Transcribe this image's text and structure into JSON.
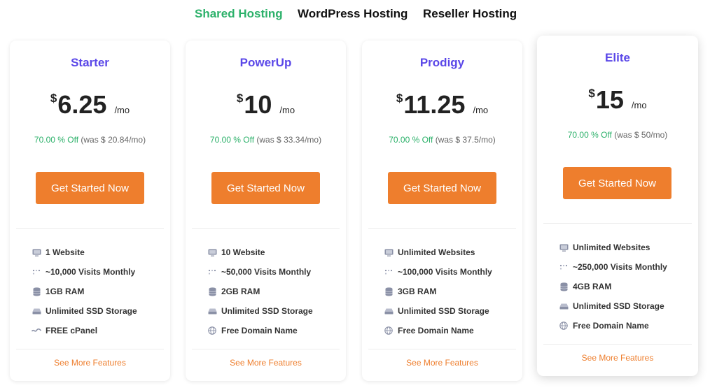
{
  "tabs": [
    {
      "label": "Shared Hosting",
      "active": true
    },
    {
      "label": "WordPress Hosting",
      "active": false
    },
    {
      "label": "Reseller Hosting",
      "active": false
    }
  ],
  "plans": [
    {
      "name": "Starter",
      "currency": "$",
      "price": "6.25",
      "period": "/mo",
      "discount_off": "70.00 % Off",
      "discount_was": "(was $ 20.84/mo)",
      "cta": "Get Started Now",
      "features": [
        {
          "icon": "monitor-icon",
          "text": "1 Website"
        },
        {
          "icon": "visits-icon",
          "text": "~10,000 Visits Monthly"
        },
        {
          "icon": "database-icon",
          "text": "1GB RAM"
        },
        {
          "icon": "drive-icon",
          "text": "Unlimited SSD Storage"
        },
        {
          "icon": "cpanel-icon",
          "text": "FREE cPanel"
        }
      ],
      "more": "See More Features"
    },
    {
      "name": "PowerUp",
      "currency": "$",
      "price": "10",
      "period": "/mo",
      "discount_off": "70.00 % Off",
      "discount_was": "(was $ 33.34/mo)",
      "cta": "Get Started Now",
      "features": [
        {
          "icon": "monitor-icon",
          "text": "10 Website"
        },
        {
          "icon": "visits-icon",
          "text": "~50,000 Visits Monthly"
        },
        {
          "icon": "database-icon",
          "text": "2GB RAM"
        },
        {
          "icon": "drive-icon",
          "text": "Unlimited SSD Storage"
        },
        {
          "icon": "globe-icon",
          "text": "Free Domain Name"
        }
      ],
      "more": "See More Features"
    },
    {
      "name": "Prodigy",
      "currency": "$",
      "price": "11.25",
      "period": "/mo",
      "discount_off": "70.00 % Off",
      "discount_was": "(was $ 37.5/mo)",
      "cta": "Get Started Now",
      "features": [
        {
          "icon": "monitor-icon",
          "text": "Unlimited Websites"
        },
        {
          "icon": "visits-icon",
          "text": "~100,000 Visits Monthly"
        },
        {
          "icon": "database-icon",
          "text": "3GB RAM"
        },
        {
          "icon": "drive-icon",
          "text": "Unlimited SSD Storage"
        },
        {
          "icon": "globe-icon",
          "text": "Free Domain Name"
        }
      ],
      "more": "See More Features"
    },
    {
      "name": "Elite",
      "currency": "$",
      "price": "15",
      "period": "/mo",
      "discount_off": "70.00 % Off",
      "discount_was": "(was $ 50/mo)",
      "cta": "Get Started Now",
      "features": [
        {
          "icon": "monitor-icon",
          "text": "Unlimited Websites"
        },
        {
          "icon": "visits-icon",
          "text": "~250,000 Visits Monthly"
        },
        {
          "icon": "database-icon",
          "text": "4GB RAM"
        },
        {
          "icon": "drive-icon",
          "text": "Unlimited SSD Storage"
        },
        {
          "icon": "globe-icon",
          "text": "Free Domain Name"
        }
      ],
      "more": "See More Features"
    }
  ],
  "colors": {
    "active_tab": "#2cb16a",
    "plan_name": "#5a47e8",
    "cta": "#ee7e2d",
    "discount_off": "#2cb16a",
    "see_more": "#ee7e2d"
  }
}
